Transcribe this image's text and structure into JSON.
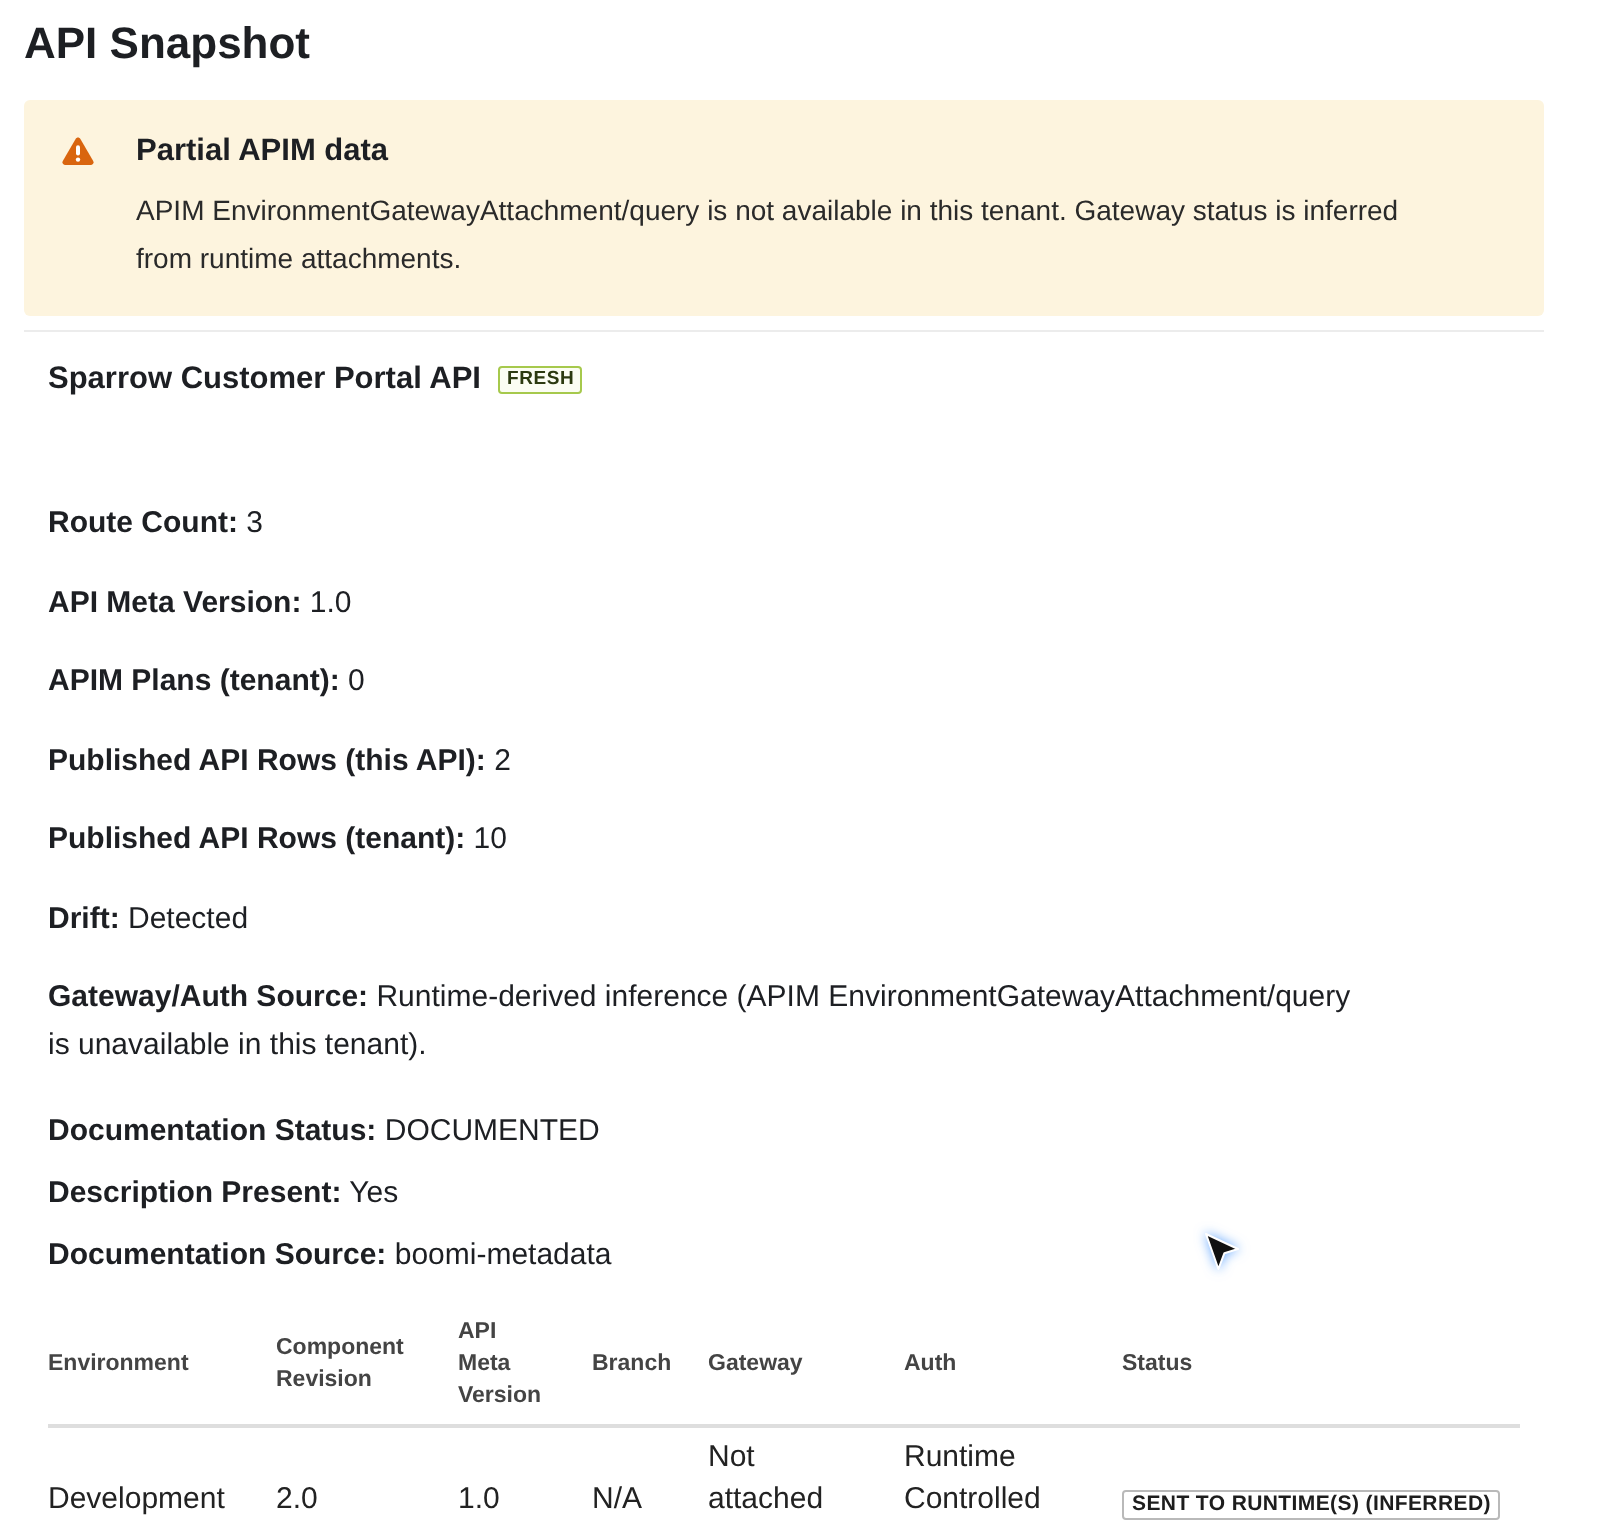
{
  "page": {
    "title": "API Snapshot"
  },
  "alert": {
    "kind": "warning",
    "title": "Partial APIM data",
    "message": "APIM EnvironmentGatewayAttachment/query is not available in this tenant. Gateway status is inferred from runtime attachments."
  },
  "api": {
    "name": "Sparrow Customer Portal API",
    "badge": "FRESH"
  },
  "details": [
    {
      "label": "Route Count:",
      "value": "3"
    },
    {
      "label": "API Meta Version:",
      "value": "1.0"
    },
    {
      "label": "APIM Plans (tenant):",
      "value": "0"
    },
    {
      "label": "Published API Rows (this API):",
      "value": "2"
    },
    {
      "label": "Published API Rows (tenant):",
      "value": "10"
    },
    {
      "label": "Drift:",
      "value": "Detected"
    },
    {
      "label": "Gateway/Auth Source:",
      "value": "Runtime-derived inference (APIM EnvironmentGatewayAttachment/query is unavailable in this tenant)."
    }
  ],
  "documentation": [
    {
      "label": "Documentation Status:",
      "value": "DOCUMENTED"
    },
    {
      "label": "Description Present:",
      "value": "Yes"
    },
    {
      "label": "Documentation Source:",
      "value": "boomi-metadata"
    }
  ],
  "table": {
    "columns": [
      "Environment",
      "Component Revision",
      "API Meta Version",
      "Branch",
      "Gateway",
      "Auth",
      "Status"
    ],
    "rows": [
      {
        "cells": [
          "Development",
          "2.0",
          "1.0",
          "N/A",
          "Not attached",
          "Runtime Controlled"
        ],
        "status": "SENT TO RUNTIME(S) (INFERRED)"
      }
    ]
  }
}
